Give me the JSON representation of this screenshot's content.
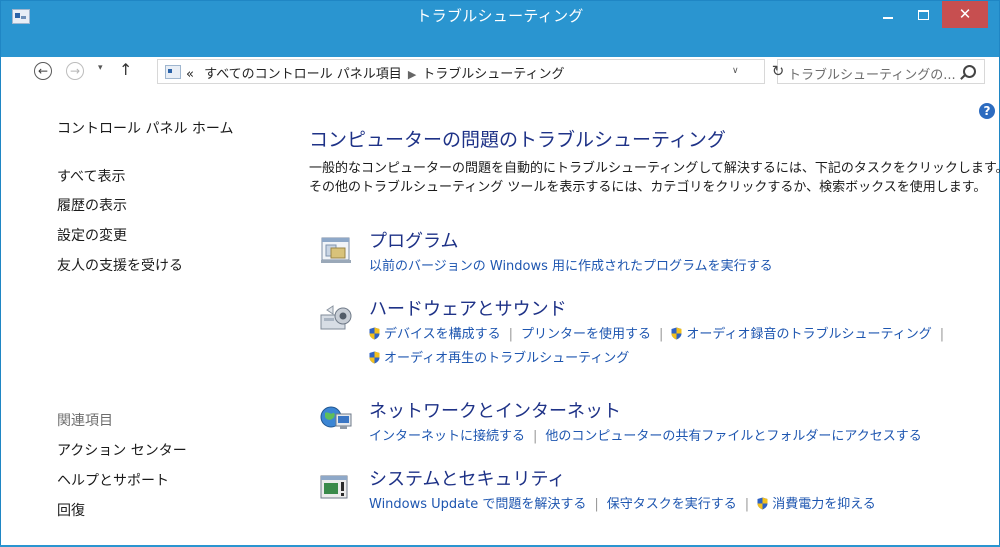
{
  "window": {
    "title": "トラブルシューティング",
    "close_label": "✕"
  },
  "nav": {
    "back": "←",
    "forward": "→",
    "recent": "▾",
    "up": "↑"
  },
  "address": {
    "overflow": "«",
    "crumbs": [
      "すべてのコントロール パネル項目",
      "トラブルシューティング"
    ],
    "dropdown": "∨",
    "refresh": "↻"
  },
  "search": {
    "placeholder": "トラブルシューティングの..."
  },
  "help": "?",
  "leftnav": {
    "home": "コントロール パネル ホーム",
    "items": [
      "すべて表示",
      "履歴の表示",
      "設定の変更",
      "友人の支援を受ける"
    ],
    "related_header": "関連項目",
    "related": [
      "アクション センター",
      "ヘルプとサポート",
      "回復"
    ]
  },
  "main": {
    "title": "コンピューターの問題のトラブルシューティング",
    "desc1": "一般的なコンピューターの問題を自動的にトラブルシューティングして解決するには、下記のタスクをクリックします。",
    "desc2": "その他のトラブルシューティング ツールを表示するには、カテゴリをクリックするか、検索ボックスを使用します。",
    "categories": [
      {
        "title": "プログラム",
        "icon": "programs-icon",
        "links": [
          "以前のバージョンの Windows 用に作成されたプログラムを実行する"
        ]
      },
      {
        "title": "ハードウェアとサウンド",
        "icon": "hardware-sound-icon",
        "links": [
          "デバイスを構成する",
          "プリンターを使用する",
          "オーディオ録音のトラブルシューティング",
          "オーディオ再生のトラブルシューティング"
        ]
      },
      {
        "title": "ネットワークとインターネット",
        "icon": "network-icon",
        "links": [
          "インターネットに接続する",
          "他のコンピューターの共有ファイルとフォルダーにアクセスする"
        ]
      },
      {
        "title": "システムとセキュリティ",
        "icon": "system-security-icon",
        "links": [
          "Windows Update で問題を解決する",
          "保守タスクを実行する",
          "消費電力を抑える"
        ]
      }
    ]
  },
  "colors": {
    "titlebar": "#2a95d0",
    "close": "#c74f50",
    "link": "#1e56b0",
    "heading": "#1e3287"
  }
}
